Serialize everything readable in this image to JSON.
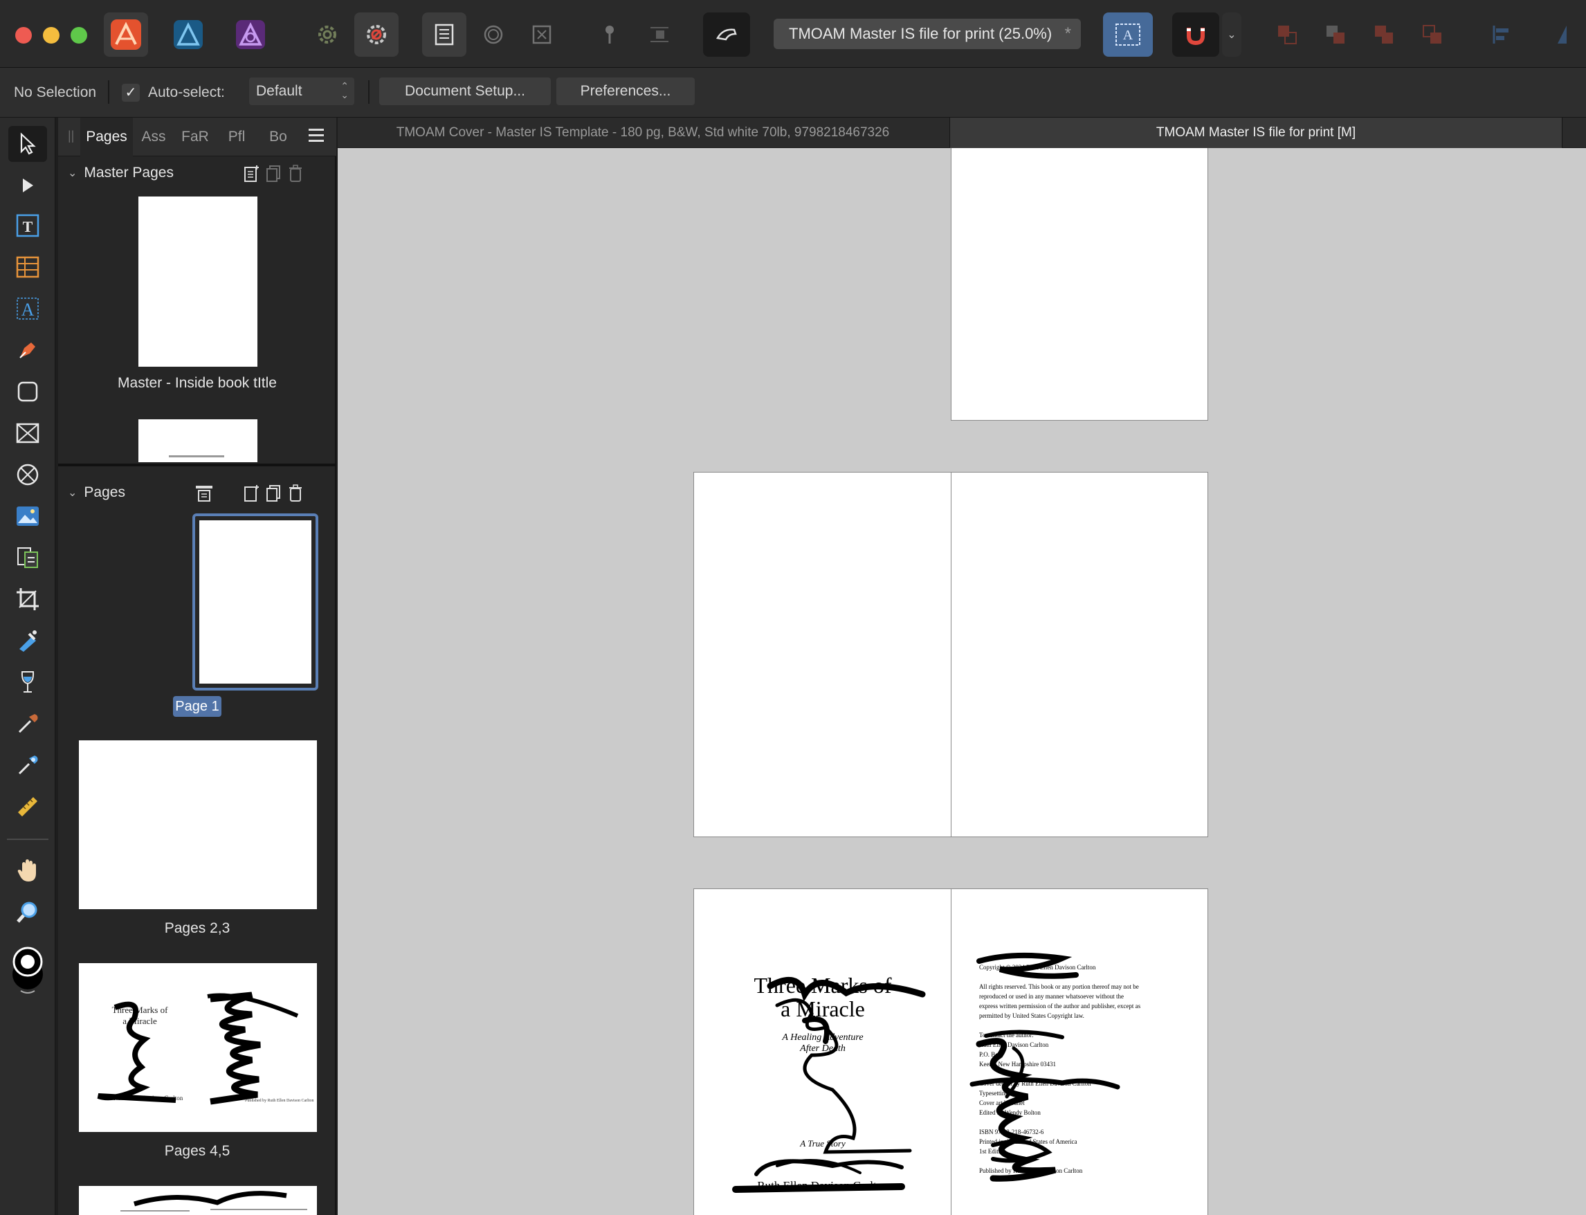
{
  "window": {
    "document_title": "TMOAM Master IS file for print (25.0%)",
    "modified_marker": "*"
  },
  "context_toolbar": {
    "selection_status": "No Selection",
    "autoselect_label": "Auto-select:",
    "autoselect_checked": true,
    "autoselect_value": "Default",
    "document_setup_label": "Document Setup...",
    "preferences_label": "Preferences..."
  },
  "studio": {
    "tabs": [
      {
        "label": "Pages",
        "active": true
      },
      {
        "label": "Ass"
      },
      {
        "label": "FaR"
      },
      {
        "label": "Pfl"
      },
      {
        "label": "Bo"
      }
    ],
    "master_pages": {
      "title": "Master Pages",
      "items": [
        {
          "label": "Master - Inside book tItle"
        }
      ]
    },
    "pages": {
      "title": "Pages",
      "items": [
        {
          "label": "Page 1",
          "selected": true
        },
        {
          "label": "Pages 2,3"
        },
        {
          "label": "Pages 4,5"
        }
      ]
    }
  },
  "document_tabs": [
    {
      "label": "TMOAM Cover - Master IS Template - 180 pg, B&W, Std white 70lb, 9798218467326",
      "active": false
    },
    {
      "label": "TMOAM Master IS file for print [M]",
      "active": true
    }
  ],
  "canvas": {
    "title_page": {
      "title_line1": "Three Marks of",
      "title_line2": "a Miracle",
      "subtitle_line1": "A Healing Adventure",
      "subtitle_line2": "After Death",
      "tagline": "A True Story",
      "author": "Ruth Ellen Davison Carlton"
    },
    "copyright_page": {
      "line1": "Copyright © 2024 Ruth Ellen Davison Carlton",
      "rights": [
        "All rights reserved. This book or any portion thereof may not be",
        "reproduced or used in any manner whatsoever without the",
        "express written permission of the author and publisher, except as",
        "permitted by United States Copyright law."
      ],
      "contact": [
        "To contact the author:",
        "Ruth Ellen Davison Carlton",
        "P.O. Box",
        "Keene, New Hampshire 03431"
      ],
      "credits": [
        "Cover design by Ruth Ellen Davison Carlton",
        "Typesetting by",
        "Cover art by Janet",
        "Edited by Wendy Bolton"
      ],
      "isbn": [
        "ISBN 979-8-218-46732-6",
        "Printed in the United States of America",
        "1st Edition"
      ],
      "publisher": "Published by Ruth Ellen Davison Carlton"
    }
  }
}
